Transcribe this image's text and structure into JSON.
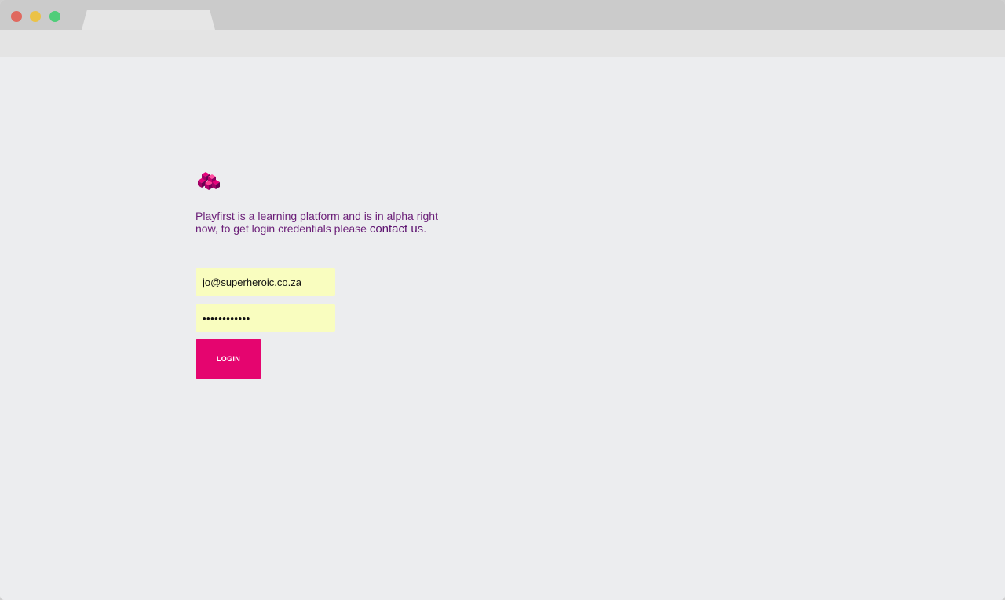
{
  "browser": {
    "tab_title": ""
  },
  "brand": {
    "logo_icon": "playfirst-cubes-logo-icon",
    "accent_color": "#e5056f",
    "text_color": "#6b1f78",
    "input_bg": "#f9fdbf"
  },
  "login": {
    "intro_text": "Playfirst is a learning platform and is in alpha right now, to get login credentials please ",
    "contact_link": "contact us",
    "intro_suffix": ".",
    "email_value": "jo@superheroic.co.za",
    "password_value": "••••••••••••",
    "login_button": "LOGIN"
  }
}
